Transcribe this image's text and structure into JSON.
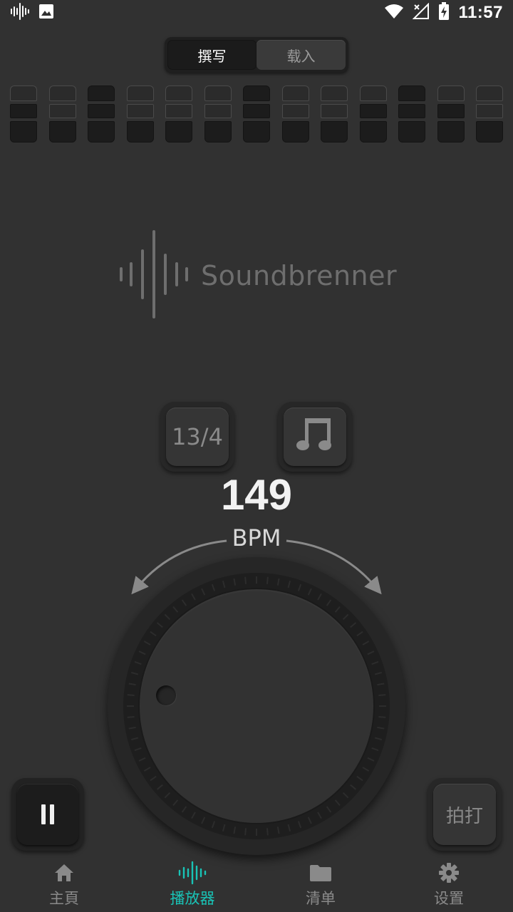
{
  "status_bar": {
    "time": "11:57",
    "left_icons": [
      "soundbrenner-waveform-icon",
      "image-icon"
    ],
    "right_icons": [
      "wifi-icon",
      "no-signal-icon",
      "battery-charging-icon"
    ]
  },
  "mode_toggle": {
    "options": [
      "撰写",
      "载入"
    ],
    "selected": "撰写"
  },
  "beat_grid": {
    "columns": [
      [
        "off",
        "on",
        "on"
      ],
      [
        "off",
        "off",
        "on"
      ],
      [
        "on",
        "on",
        "on"
      ],
      [
        "off",
        "off",
        "on"
      ],
      [
        "off",
        "off",
        "on"
      ],
      [
        "off",
        "off",
        "on"
      ],
      [
        "on",
        "on",
        "on"
      ],
      [
        "off",
        "off",
        "on"
      ],
      [
        "off",
        "off",
        "on"
      ],
      [
        "off",
        "on",
        "on"
      ],
      [
        "on",
        "on",
        "on"
      ],
      [
        "off",
        "on",
        "on"
      ],
      [
        "off",
        "off",
        "on"
      ]
    ]
  },
  "logo": {
    "text": "Soundbrenner"
  },
  "controls": {
    "time_signature": "13/4",
    "note_icon": "beamed-notes-icon"
  },
  "tempo": {
    "value": "149",
    "unit": "BPM"
  },
  "buttons": {
    "pause_icon": "pause-icon",
    "tap_label": "拍打"
  },
  "nav": {
    "items": [
      {
        "label": "主頁",
        "icon": "home-icon",
        "active": false
      },
      {
        "label": "播放器",
        "icon": "waveform-icon",
        "active": true
      },
      {
        "label": "清单",
        "icon": "folder-icon",
        "active": false
      },
      {
        "label": "设置",
        "icon": "gear-icon",
        "active": false
      }
    ]
  },
  "colors": {
    "background": "#313131",
    "accent": "#19c3b6",
    "cell_on": "#1c1c1c",
    "cell_off": "#2b2b2b"
  }
}
